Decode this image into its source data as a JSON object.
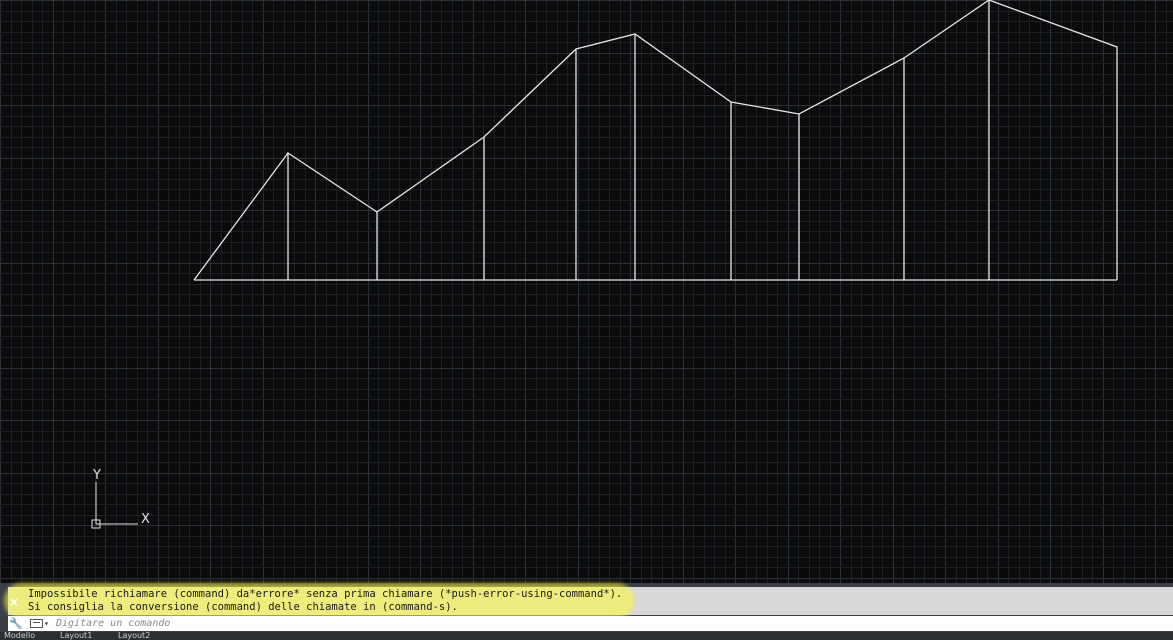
{
  "viewport": {
    "background": "#0b0b0c",
    "grid_minor_color": "#1b1f26",
    "grid_major_color": "#2a303a",
    "line_color": "#e6e6e6",
    "ucs": {
      "x_label": "X",
      "y_label": "Y"
    }
  },
  "command": {
    "history": [
      "Impossibile richiamare (command) da*errore* senza prima chiamare (*push-error-using-command*).",
      "Si consiglia la conversione (command) delle chiamate in (command-s)."
    ],
    "highlight_color": "#ffff33",
    "close_label": "×",
    "placeholder": "Digitare un comando"
  },
  "layout_tabs": [
    "Modello",
    "Layout1",
    "Layout2"
  ]
}
